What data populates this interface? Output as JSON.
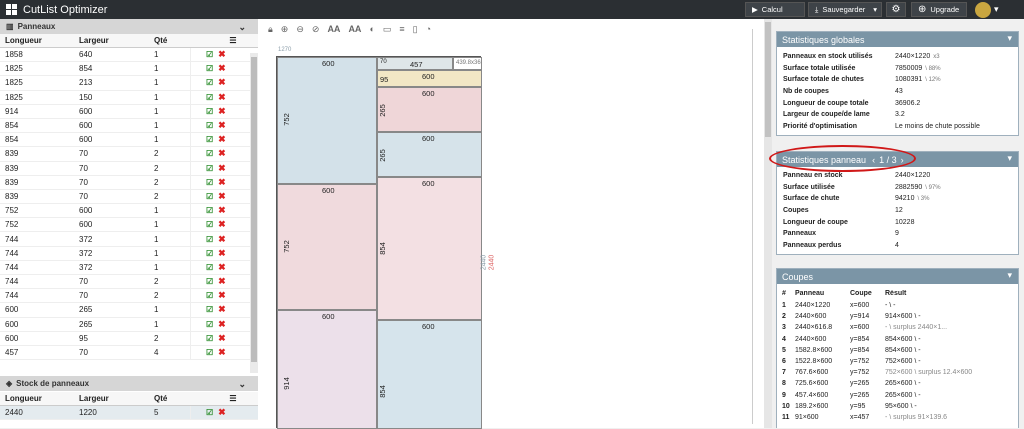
{
  "app": {
    "title": "CutList Optimizer"
  },
  "toolbar": {
    "calcul": "Calcul",
    "sauvegarder": "Sauvegarder",
    "upgrade": "Upgrade"
  },
  "panneaux": {
    "title": "Panneaux",
    "headers": [
      "Longueur",
      "Largeur",
      "Qté"
    ],
    "rows": [
      [
        "1858",
        "640",
        "1"
      ],
      [
        "1825",
        "854",
        "1"
      ],
      [
        "1825",
        "213",
        "1"
      ],
      [
        "1825",
        "150",
        "1"
      ],
      [
        "914",
        "600",
        "1"
      ],
      [
        "854",
        "600",
        "1"
      ],
      [
        "854",
        "600",
        "1"
      ],
      [
        "839",
        "70",
        "2"
      ],
      [
        "839",
        "70",
        "2"
      ],
      [
        "839",
        "70",
        "2"
      ],
      [
        "839",
        "70",
        "2"
      ],
      [
        "752",
        "600",
        "1"
      ],
      [
        "752",
        "600",
        "1"
      ],
      [
        "744",
        "372",
        "1"
      ],
      [
        "744",
        "372",
        "1"
      ],
      [
        "744",
        "372",
        "1"
      ],
      [
        "744",
        "70",
        "2"
      ],
      [
        "744",
        "70",
        "2"
      ],
      [
        "600",
        "265",
        "1"
      ],
      [
        "600",
        "265",
        "1"
      ],
      [
        "600",
        "95",
        "2"
      ],
      [
        "457",
        "70",
        "4"
      ]
    ]
  },
  "stock": {
    "title": "Stock de panneaux",
    "headers": [
      "Longueur",
      "Largeur",
      "Qté"
    ],
    "rows": [
      [
        "2440",
        "1220",
        "5"
      ]
    ]
  },
  "canvas": {
    "top_label": "1270",
    "right_label": "2440",
    "right_label2": "2440",
    "corner_label": "439.8x36",
    "pieces": [
      {
        "w": "600",
        "h": "752"
      },
      {
        "w": "457",
        "h": "70"
      },
      {
        "w": "600",
        "h": "95"
      },
      {
        "w": "600",
        "h": "265"
      },
      {
        "w": "600",
        "h": "265"
      },
      {
        "w": "600",
        "h": "752"
      },
      {
        "w": "600",
        "h": "854"
      },
      {
        "w": "600",
        "h": "914"
      },
      {
        "w": "600",
        "h": "854"
      }
    ]
  },
  "stats_globales": {
    "title": "Statistiques globales",
    "rows": [
      {
        "k": "Panneaux en stock utilisés",
        "v": "2440×1220",
        "x": "x3"
      },
      {
        "k": "Surface totale utilisée",
        "v": "7850009",
        "x": "\\ 88%"
      },
      {
        "k": "Surface totale de chutes",
        "v": "1080391",
        "x": "\\ 12%"
      },
      {
        "k": "Nb de coupes",
        "v": "43",
        "x": ""
      },
      {
        "k": "Longueur de coupe totale",
        "v": "36906.2",
        "x": ""
      },
      {
        "k": "Largeur de coupe/de lame",
        "v": "3.2",
        "x": ""
      },
      {
        "k": "Priorité d'optimisation",
        "v": "Le moins de chute possible",
        "x": ""
      }
    ]
  },
  "stats_panneau": {
    "title": "Statistiques panneau",
    "page": "1 / 3",
    "rows": [
      {
        "k": "Panneau en stock",
        "v": "2440×1220",
        "x": ""
      },
      {
        "k": "Surface utilisée",
        "v": "2882590",
        "x": "\\ 97%"
      },
      {
        "k": "Surface de chute",
        "v": "94210",
        "x": "\\ 3%"
      },
      {
        "k": "Coupes",
        "v": "12",
        "x": ""
      },
      {
        "k": "Longueur de coupe",
        "v": "10228",
        "x": ""
      },
      {
        "k": "Panneaux",
        "v": "9",
        "x": ""
      },
      {
        "k": "Panneaux perdus",
        "v": "4",
        "x": ""
      }
    ]
  },
  "coupes": {
    "title": "Coupes",
    "headers": [
      "#",
      "Panneau",
      "Coupe",
      "Résult"
    ],
    "rows": [
      {
        "n": "1",
        "p": "2440×1220",
        "c": "x=600",
        "r": "- \\ -",
        "e": ""
      },
      {
        "n": "2",
        "p": "2440×600",
        "c": "y=914",
        "r": "914×600 \\ -",
        "e": ""
      },
      {
        "n": "3",
        "p": "2440×616.8",
        "c": "x=600",
        "r": "- \\ surplus 2440×1...",
        "e": "grey"
      },
      {
        "n": "4",
        "p": "2440×600",
        "c": "y=854",
        "r": "854×600 \\ -",
        "e": ""
      },
      {
        "n": "5",
        "p": "1582.8×600",
        "c": "y=854",
        "r": "854×600 \\ -",
        "e": ""
      },
      {
        "n": "6",
        "p": "1522.8×600",
        "c": "y=752",
        "r": "752×600 \\ -",
        "e": ""
      },
      {
        "n": "7",
        "p": "767.6×600",
        "c": "y=752",
        "r": "752×600 \\ surplus 12.4×600",
        "e": "grey"
      },
      {
        "n": "8",
        "p": "725.6×600",
        "c": "y=265",
        "r": "265×600 \\ -",
        "e": ""
      },
      {
        "n": "9",
        "p": "457.4×600",
        "c": "y=265",
        "r": "265×600 \\ -",
        "e": ""
      },
      {
        "n": "10",
        "p": "189.2×600",
        "c": "y=95",
        "r": "95×600 \\ -",
        "e": ""
      },
      {
        "n": "11",
        "p": "91×600",
        "c": "x=457",
        "r": "- \\ surplus 91×139.6",
        "e": "grey"
      }
    ]
  },
  "colors": {
    "topbar": "#2b2f33",
    "panel_head": "#7b95a6",
    "annotation": "#d01818"
  }
}
